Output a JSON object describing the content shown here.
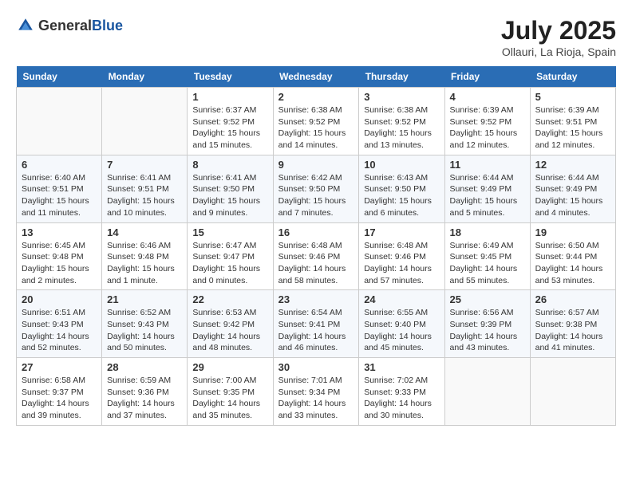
{
  "header": {
    "logo_general": "General",
    "logo_blue": "Blue",
    "month_year": "July 2025",
    "location": "Ollauri, La Rioja, Spain"
  },
  "weekdays": [
    "Sunday",
    "Monday",
    "Tuesday",
    "Wednesday",
    "Thursday",
    "Friday",
    "Saturday"
  ],
  "weeks": [
    [
      {
        "day": "",
        "info": ""
      },
      {
        "day": "",
        "info": ""
      },
      {
        "day": "1",
        "info": "Sunrise: 6:37 AM\nSunset: 9:52 PM\nDaylight: 15 hours and 15 minutes."
      },
      {
        "day": "2",
        "info": "Sunrise: 6:38 AM\nSunset: 9:52 PM\nDaylight: 15 hours and 14 minutes."
      },
      {
        "day": "3",
        "info": "Sunrise: 6:38 AM\nSunset: 9:52 PM\nDaylight: 15 hours and 13 minutes."
      },
      {
        "day": "4",
        "info": "Sunrise: 6:39 AM\nSunset: 9:52 PM\nDaylight: 15 hours and 12 minutes."
      },
      {
        "day": "5",
        "info": "Sunrise: 6:39 AM\nSunset: 9:51 PM\nDaylight: 15 hours and 12 minutes."
      }
    ],
    [
      {
        "day": "6",
        "info": "Sunrise: 6:40 AM\nSunset: 9:51 PM\nDaylight: 15 hours and 11 minutes."
      },
      {
        "day": "7",
        "info": "Sunrise: 6:41 AM\nSunset: 9:51 PM\nDaylight: 15 hours and 10 minutes."
      },
      {
        "day": "8",
        "info": "Sunrise: 6:41 AM\nSunset: 9:50 PM\nDaylight: 15 hours and 9 minutes."
      },
      {
        "day": "9",
        "info": "Sunrise: 6:42 AM\nSunset: 9:50 PM\nDaylight: 15 hours and 7 minutes."
      },
      {
        "day": "10",
        "info": "Sunrise: 6:43 AM\nSunset: 9:50 PM\nDaylight: 15 hours and 6 minutes."
      },
      {
        "day": "11",
        "info": "Sunrise: 6:44 AM\nSunset: 9:49 PM\nDaylight: 15 hours and 5 minutes."
      },
      {
        "day": "12",
        "info": "Sunrise: 6:44 AM\nSunset: 9:49 PM\nDaylight: 15 hours and 4 minutes."
      }
    ],
    [
      {
        "day": "13",
        "info": "Sunrise: 6:45 AM\nSunset: 9:48 PM\nDaylight: 15 hours and 2 minutes."
      },
      {
        "day": "14",
        "info": "Sunrise: 6:46 AM\nSunset: 9:48 PM\nDaylight: 15 hours and 1 minute."
      },
      {
        "day": "15",
        "info": "Sunrise: 6:47 AM\nSunset: 9:47 PM\nDaylight: 15 hours and 0 minutes."
      },
      {
        "day": "16",
        "info": "Sunrise: 6:48 AM\nSunset: 9:46 PM\nDaylight: 14 hours and 58 minutes."
      },
      {
        "day": "17",
        "info": "Sunrise: 6:48 AM\nSunset: 9:46 PM\nDaylight: 14 hours and 57 minutes."
      },
      {
        "day": "18",
        "info": "Sunrise: 6:49 AM\nSunset: 9:45 PM\nDaylight: 14 hours and 55 minutes."
      },
      {
        "day": "19",
        "info": "Sunrise: 6:50 AM\nSunset: 9:44 PM\nDaylight: 14 hours and 53 minutes."
      }
    ],
    [
      {
        "day": "20",
        "info": "Sunrise: 6:51 AM\nSunset: 9:43 PM\nDaylight: 14 hours and 52 minutes."
      },
      {
        "day": "21",
        "info": "Sunrise: 6:52 AM\nSunset: 9:43 PM\nDaylight: 14 hours and 50 minutes."
      },
      {
        "day": "22",
        "info": "Sunrise: 6:53 AM\nSunset: 9:42 PM\nDaylight: 14 hours and 48 minutes."
      },
      {
        "day": "23",
        "info": "Sunrise: 6:54 AM\nSunset: 9:41 PM\nDaylight: 14 hours and 46 minutes."
      },
      {
        "day": "24",
        "info": "Sunrise: 6:55 AM\nSunset: 9:40 PM\nDaylight: 14 hours and 45 minutes."
      },
      {
        "day": "25",
        "info": "Sunrise: 6:56 AM\nSunset: 9:39 PM\nDaylight: 14 hours and 43 minutes."
      },
      {
        "day": "26",
        "info": "Sunrise: 6:57 AM\nSunset: 9:38 PM\nDaylight: 14 hours and 41 minutes."
      }
    ],
    [
      {
        "day": "27",
        "info": "Sunrise: 6:58 AM\nSunset: 9:37 PM\nDaylight: 14 hours and 39 minutes."
      },
      {
        "day": "28",
        "info": "Sunrise: 6:59 AM\nSunset: 9:36 PM\nDaylight: 14 hours and 37 minutes."
      },
      {
        "day": "29",
        "info": "Sunrise: 7:00 AM\nSunset: 9:35 PM\nDaylight: 14 hours and 35 minutes."
      },
      {
        "day": "30",
        "info": "Sunrise: 7:01 AM\nSunset: 9:34 PM\nDaylight: 14 hours and 33 minutes."
      },
      {
        "day": "31",
        "info": "Sunrise: 7:02 AM\nSunset: 9:33 PM\nDaylight: 14 hours and 30 minutes."
      },
      {
        "day": "",
        "info": ""
      },
      {
        "day": "",
        "info": ""
      }
    ]
  ]
}
